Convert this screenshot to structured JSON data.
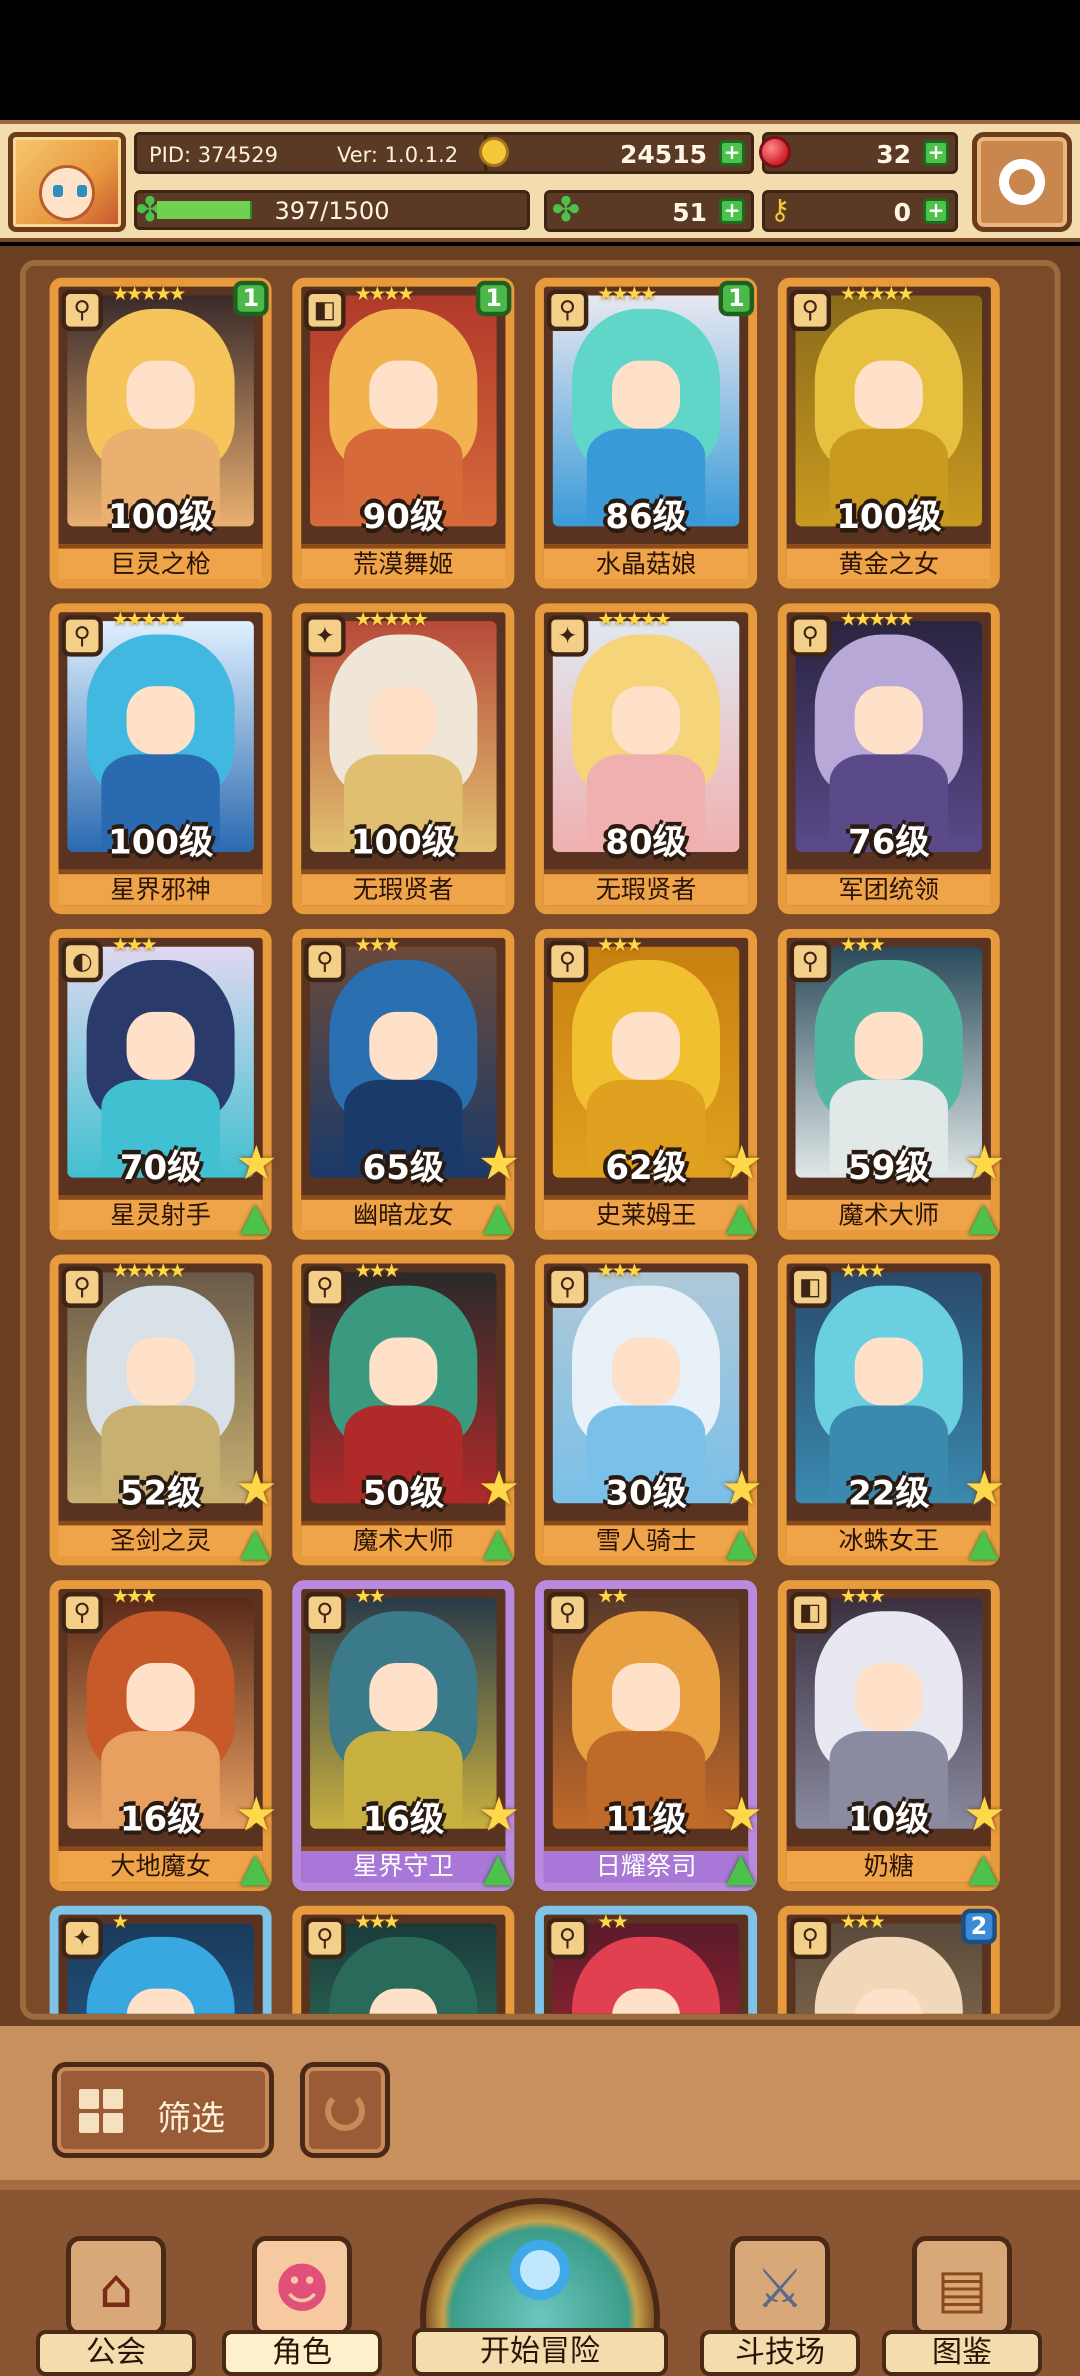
{
  "header": {
    "pid": "PID: 374529",
    "version": "Ver: 1.0.1.2",
    "gold": "24515",
    "gems": "32",
    "xp_text": "397/1500",
    "xp_fraction": 0.265,
    "clovers": "51",
    "keys": "0",
    "icons": {
      "avatar": "player-avatar",
      "gold": "gold-coin-icon",
      "gem": "red-gem-icon",
      "clover": "clover-icon",
      "key": "key-icon",
      "settings": "gear-icon"
    }
  },
  "cards": [
    {
      "level": "100级",
      "name": "巨灵之枪",
      "stars": "★★★★★",
      "badge": "1",
      "frame": "gold",
      "cls": "⚲",
      "palette": [
        "#f5c45a",
        "#e9b070",
        "#3a2a2a"
      ]
    },
    {
      "level": "90级",
      "name": "荒漠舞姬",
      "stars": "★★★★",
      "badge": "1",
      "frame": "gold",
      "cls": "◧",
      "palette": [
        "#f2b250",
        "#d66a3a",
        "#b13a2a"
      ]
    },
    {
      "level": "86级",
      "name": "水晶菇娘",
      "stars": "★★★★",
      "badge": "1",
      "frame": "gold",
      "cls": "⚲",
      "palette": [
        "#5fd6c8",
        "#3a9ad8",
        "#e8e8f0"
      ]
    },
    {
      "level": "100级",
      "name": "黄金之女",
      "stars": "★★★★★",
      "badge": "",
      "frame": "gold",
      "cls": "⚲",
      "palette": [
        "#e8c040",
        "#c89a20",
        "#8a6a1a"
      ]
    },
    {
      "level": "100级",
      "name": "星界邪神",
      "stars": "★★★★★",
      "badge": "",
      "frame": "gold",
      "cls": "⚲",
      "palette": [
        "#40b8e0",
        "#2a6ab0",
        "#e0f0ff"
      ]
    },
    {
      "level": "100级",
      "name": "无瑕贤者",
      "stars": "★★★★★",
      "badge": "",
      "frame": "gold",
      "cls": "✦",
      "palette": [
        "#f0e6d8",
        "#e0c070",
        "#b84a3a"
      ]
    },
    {
      "level": "80级",
      "name": "无瑕贤者",
      "stars": "★★★★★",
      "badge": "",
      "frame": "gold",
      "cls": "✦",
      "palette": [
        "#f6d47a",
        "#f0b0b0",
        "#e0e8f0"
      ]
    },
    {
      "level": "76级",
      "name": "军团统领",
      "stars": "★★★★★",
      "badge": "",
      "frame": "gold",
      "cls": "⚲",
      "palette": [
        "#b8a8d8",
        "#5a4a8a",
        "#2a2440"
      ]
    },
    {
      "level": "70级",
      "name": "星灵射手",
      "stars": "★★★",
      "badge": "",
      "frame": "gold",
      "cls": "◐",
      "palette": [
        "#2a3a6a",
        "#40c0d0",
        "#e0d8f0"
      ],
      "upgrade": true
    },
    {
      "level": "65级",
      "name": "幽暗龙女",
      "stars": "★★★",
      "badge": "",
      "frame": "gold",
      "cls": "⚲",
      "palette": [
        "#2a70b0",
        "#1a3a6a",
        "#6a4a3a"
      ],
      "upgrade": true
    },
    {
      "level": "62级",
      "name": "史莱姆王",
      "stars": "★★★",
      "badge": "",
      "frame": "gold",
      "cls": "⚲",
      "palette": [
        "#f0c030",
        "#e0a020",
        "#c88010"
      ],
      "upgrade": true
    },
    {
      "level": "59级",
      "name": "魔术大师",
      "stars": "★★★",
      "badge": "",
      "frame": "gold",
      "cls": "⚲",
      "palette": [
        "#50b8a0",
        "#e0e8e8",
        "#2a4a5a"
      ],
      "upgrade": true
    },
    {
      "level": "52级",
      "name": "圣剑之灵",
      "stars": "★★★★★",
      "badge": "",
      "frame": "gold",
      "cls": "⚲",
      "palette": [
        "#d8e0e8",
        "#c8b070",
        "#6a5a4a"
      ],
      "upgrade": true
    },
    {
      "level": "50级",
      "name": "魔术大师",
      "stars": "★★★",
      "badge": "",
      "frame": "gold",
      "cls": "⚲",
      "palette": [
        "#3a9a80",
        "#b02a2a",
        "#2a2a2a"
      ],
      "upgrade": true
    },
    {
      "level": "30级",
      "name": "雪人骑士",
      "stars": "★★★",
      "badge": "",
      "frame": "gold",
      "cls": "⚲",
      "palette": [
        "#e8f0f8",
        "#7ac0e8",
        "#b0c8d8"
      ],
      "upgrade": true
    },
    {
      "level": "22级",
      "name": "冰蛛女王",
      "stars": "★★★",
      "badge": "",
      "frame": "gold",
      "cls": "◧",
      "palette": [
        "#6ad0e0",
        "#3a8ab0",
        "#2a4a6a"
      ],
      "upgrade": true
    },
    {
      "level": "16级",
      "name": "大地魔女",
      "stars": "★★★",
      "badge": "",
      "frame": "gold",
      "cls": "⚲",
      "palette": [
        "#c85a2a",
        "#e8a060",
        "#5a2a1a"
      ],
      "upgrade": true
    },
    {
      "level": "16级",
      "name": "星界守卫",
      "stars": "★★",
      "badge": "",
      "frame": "purple",
      "cls": "⚲",
      "palette": [
        "#3a7a8a",
        "#c8b040",
        "#2a3a4a"
      ],
      "upgrade": true
    },
    {
      "level": "11级",
      "name": "日耀祭司",
      "stars": "★★",
      "badge": "",
      "frame": "purple",
      "cls": "⚲",
      "palette": [
        "#e8a040",
        "#c06a2a",
        "#5a3a2a"
      ],
      "upgrade": true
    },
    {
      "level": "10级",
      "name": "奶糖",
      "stars": "★★★",
      "badge": "",
      "frame": "gold",
      "cls": "◧",
      "palette": [
        "#e8e8f0",
        "#8a8aa0",
        "#3a3040"
      ],
      "upgrade": true
    },
    {
      "level": "",
      "name": "",
      "stars": "★",
      "badge": "",
      "frame": "blue",
      "cls": "✦",
      "palette": [
        "#3aa8e0",
        "#2a6aa0",
        "#1a3a5a"
      ]
    },
    {
      "level": "",
      "name": "",
      "stars": "★★★",
      "badge": "",
      "frame": "gold",
      "cls": "⚲",
      "palette": [
        "#2a6a5a",
        "#3a8a6a",
        "#1a3a3a"
      ]
    },
    {
      "level": "",
      "name": "",
      "stars": "★★",
      "badge": "",
      "frame": "blue",
      "cls": "⚲",
      "palette": [
        "#e04050",
        "#c02a3a",
        "#5a1a2a"
      ]
    },
    {
      "level": "",
      "name": "",
      "stars": "★★★",
      "badge": "2",
      "frame": "gold",
      "cls": "⚲",
      "palette": [
        "#f0d8b8",
        "#a08060",
        "#5a4a3a"
      ]
    }
  ],
  "filter": {
    "label": "筛选"
  },
  "nav": {
    "guild": "公会",
    "character": "角色",
    "adventure": "开始冒险",
    "arena": "斗技场",
    "codex": "图鉴"
  }
}
